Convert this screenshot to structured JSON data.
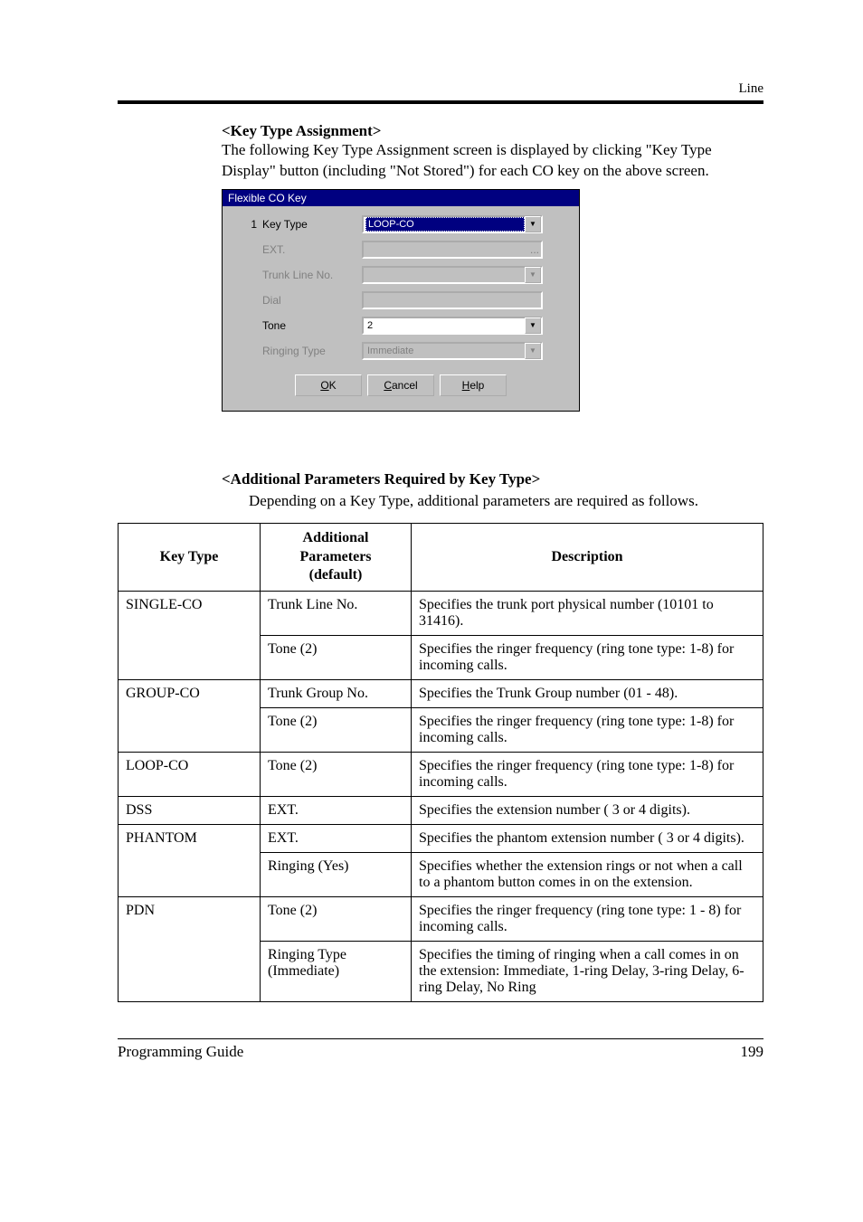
{
  "header": {
    "right": "Line"
  },
  "section1": {
    "title": "<Key Type Assignment>",
    "text": "The following Key Type Assignment screen is displayed by clicking \"Key Type Display\" button (including \"Not Stored\") for each CO key on the above screen."
  },
  "dialog": {
    "title": "Flexible CO Key",
    "num": "1",
    "rows": {
      "key_type": {
        "label": "Key Type",
        "value": "LOOP-CO"
      },
      "ext": {
        "label": "EXT.",
        "value": "..."
      },
      "trunk": {
        "label": "Trunk Line No.",
        "value": ""
      },
      "dial": {
        "label": "Dial",
        "value": ""
      },
      "tone": {
        "label": "Tone",
        "value": "2"
      },
      "ringing": {
        "label": "Ringing Type",
        "value": "Immediate"
      }
    },
    "buttons": {
      "ok_u": "O",
      "ok_r": "K",
      "cancel_u": "C",
      "cancel_r": "ancel",
      "help_u": "H",
      "help_r": "elp"
    }
  },
  "section2": {
    "title": "<Additional Parameters Required by Key Type>",
    "text": "Depending on a Key Type, additional parameters are required as follows."
  },
  "table": {
    "headers": {
      "col1": "Key Type",
      "col2a": "Additional",
      "col2b": "Parameters",
      "col2c": "(default)",
      "col3": "Description"
    },
    "rows": [
      {
        "kt": "SINGLE-CO",
        "ap": "Trunk Line No.",
        "desc": "Specifies the trunk port physical number (10101 to 31416)."
      },
      {
        "kt": "",
        "ap": "Tone (2)",
        "desc": "Specifies the ringer frequency (ring tone type: 1-8) for incoming calls."
      },
      {
        "kt": "GROUP-CO",
        "ap": "Trunk Group No.",
        "desc": "Specifies the Trunk Group number (01 - 48)."
      },
      {
        "kt": "",
        "ap": "Tone (2)",
        "desc": "Specifies the ringer frequency (ring tone type: 1-8) for incoming calls."
      },
      {
        "kt": "LOOP-CO",
        "ap": "Tone (2)",
        "desc": "Specifies the ringer frequency (ring tone type: 1-8) for incoming calls."
      },
      {
        "kt": "DSS",
        "ap": "EXT.",
        "desc": "Specifies the extension number ( 3 or 4 digits)."
      },
      {
        "kt": "PHANTOM",
        "ap": "EXT.",
        "desc": "Specifies the phantom extension number ( 3 or 4 digits)."
      },
      {
        "kt": "",
        "ap": "Ringing (Yes)",
        "desc": "Specifies whether the extension rings or not when a call to a phantom button comes in on the extension."
      },
      {
        "kt": "PDN",
        "ap": "Tone (2)",
        "desc": "Specifies the ringer frequency (ring tone type: 1 - 8) for incoming calls."
      },
      {
        "kt": "",
        "ap": "Ringing Type (Immediate)",
        "desc": "Specifies the timing of ringing when a call comes in on the extension: Immediate, 1-ring Delay, 3-ring Delay, 6-ring Delay, No Ring"
      }
    ]
  },
  "footer": {
    "left": "Programming Guide",
    "right": "199"
  }
}
